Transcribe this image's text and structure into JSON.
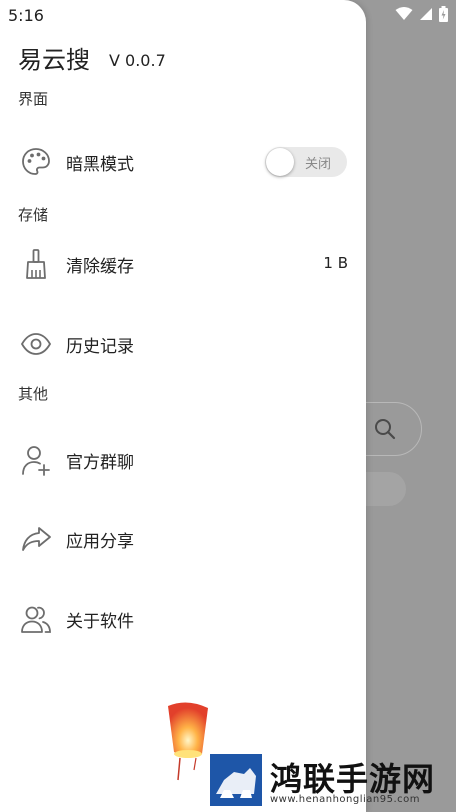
{
  "status_bar": {
    "time": "5:16"
  },
  "drawer": {
    "app_title": "易云搜",
    "version": "V 0.0.7",
    "sections": [
      {
        "title": "界面"
      },
      {
        "title": "存储"
      },
      {
        "title": "其他"
      }
    ],
    "items": {
      "dark_mode": {
        "label": "暗黑模式",
        "icon": "palette-icon",
        "toggle_text": "关闭",
        "toggle_on": false
      },
      "clear_cache": {
        "label": "清除缓存",
        "icon": "broom-icon",
        "value": "1 B"
      },
      "history": {
        "label": "历史记录",
        "icon": "eye-icon"
      },
      "group_chat": {
        "label": "官方群聊",
        "icon": "add-user-icon"
      },
      "share": {
        "label": "应用分享",
        "icon": "share-arrow-icon"
      },
      "about": {
        "label": "关于软件",
        "icon": "users-icon"
      }
    }
  },
  "watermark": {
    "text": "鸿联手游网",
    "url": "www.henanhonglian95.com"
  },
  "colors": {
    "scrim": "#9a9a9a",
    "drawer_bg": "#ffffff",
    "toggle_off_bg": "#e9e9e9",
    "watermark_blue": "#1e56a8"
  }
}
